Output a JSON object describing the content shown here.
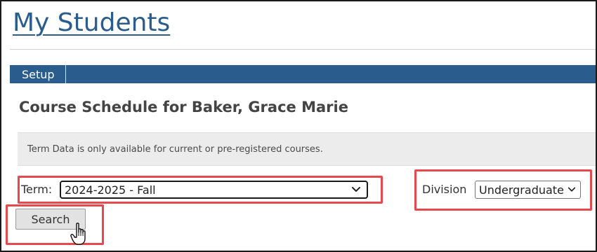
{
  "page": {
    "title": "My Students"
  },
  "navbar": {
    "items": [
      {
        "label": "Setup"
      }
    ]
  },
  "heading": "Course Schedule for Baker, Grace Marie",
  "info": {
    "message": "Term Data is only available for current or pre-registered courses."
  },
  "form": {
    "term": {
      "label": "Term:",
      "selected": "2024-2025 - Fall"
    },
    "division": {
      "label": "Division",
      "selected": "Undergraduate"
    },
    "search_button": "Search"
  },
  "colors": {
    "brand_blue": "#2a5c8e",
    "highlight_red": "#e5484d",
    "info_background": "#ececec"
  },
  "icons": {
    "dropdown": "chevron-down-icon",
    "cursor": "hand-pointer-icon"
  }
}
